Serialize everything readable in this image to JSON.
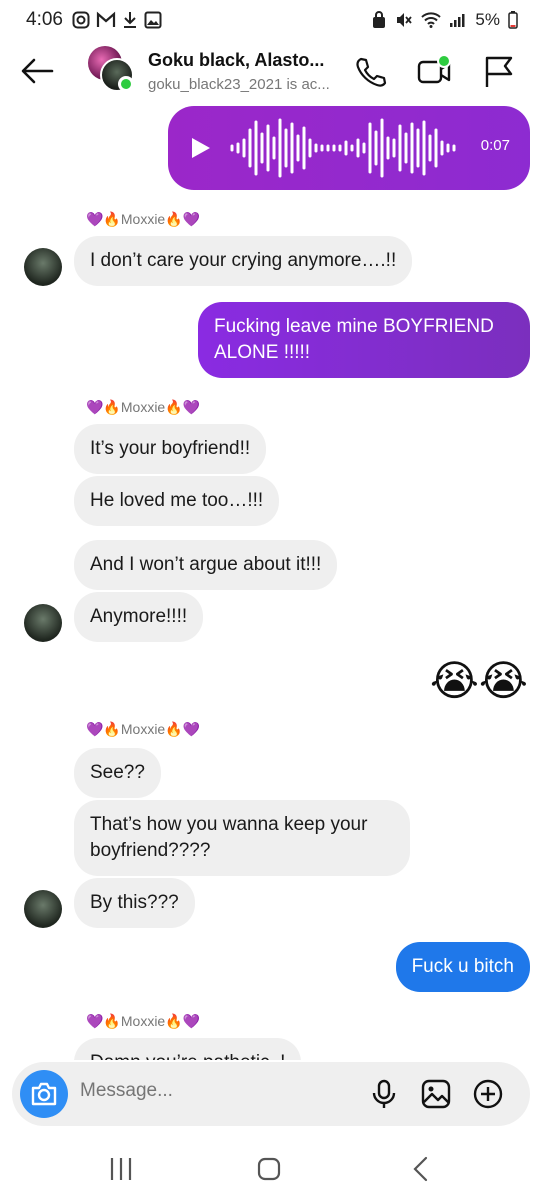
{
  "status": {
    "time": "4:06",
    "battery": "5%"
  },
  "header": {
    "title": "Goku black, Alasto...",
    "subtitle": "goku_black23_2021 is ac..."
  },
  "voice_message": {
    "duration": "0:07"
  },
  "messages": {
    "sender_name": "Moxxie",
    "m1": "I don’t care your crying anymore….!!",
    "m2_line1": "Fucking leave mine BOYFRIEND",
    "m2_line2": "ALONE !!!!!",
    "m3": "It’s your boyfriend!!",
    "m4": "He loved me too…!!!",
    "m5": "And I won’t argue about it!!!",
    "m6": "Anymore!!!!",
    "m7": "😭😭",
    "m8": "See??",
    "m9_line1": "That’s how you wanna keep your",
    "m9_line2": "boyfriend????",
    "m10": "By this???",
    "m11": "Fuck u bitch",
    "m12": "Damn you’re pathetic..!"
  },
  "composer": {
    "placeholder": "Message..."
  },
  "colors": {
    "outgoing_purple": "#8a2be2",
    "outgoing_blue": "#1f78ea",
    "incoming_gray": "#efefef",
    "online_green": "#2ecc40",
    "camera_blue": "#2f8ef5"
  }
}
